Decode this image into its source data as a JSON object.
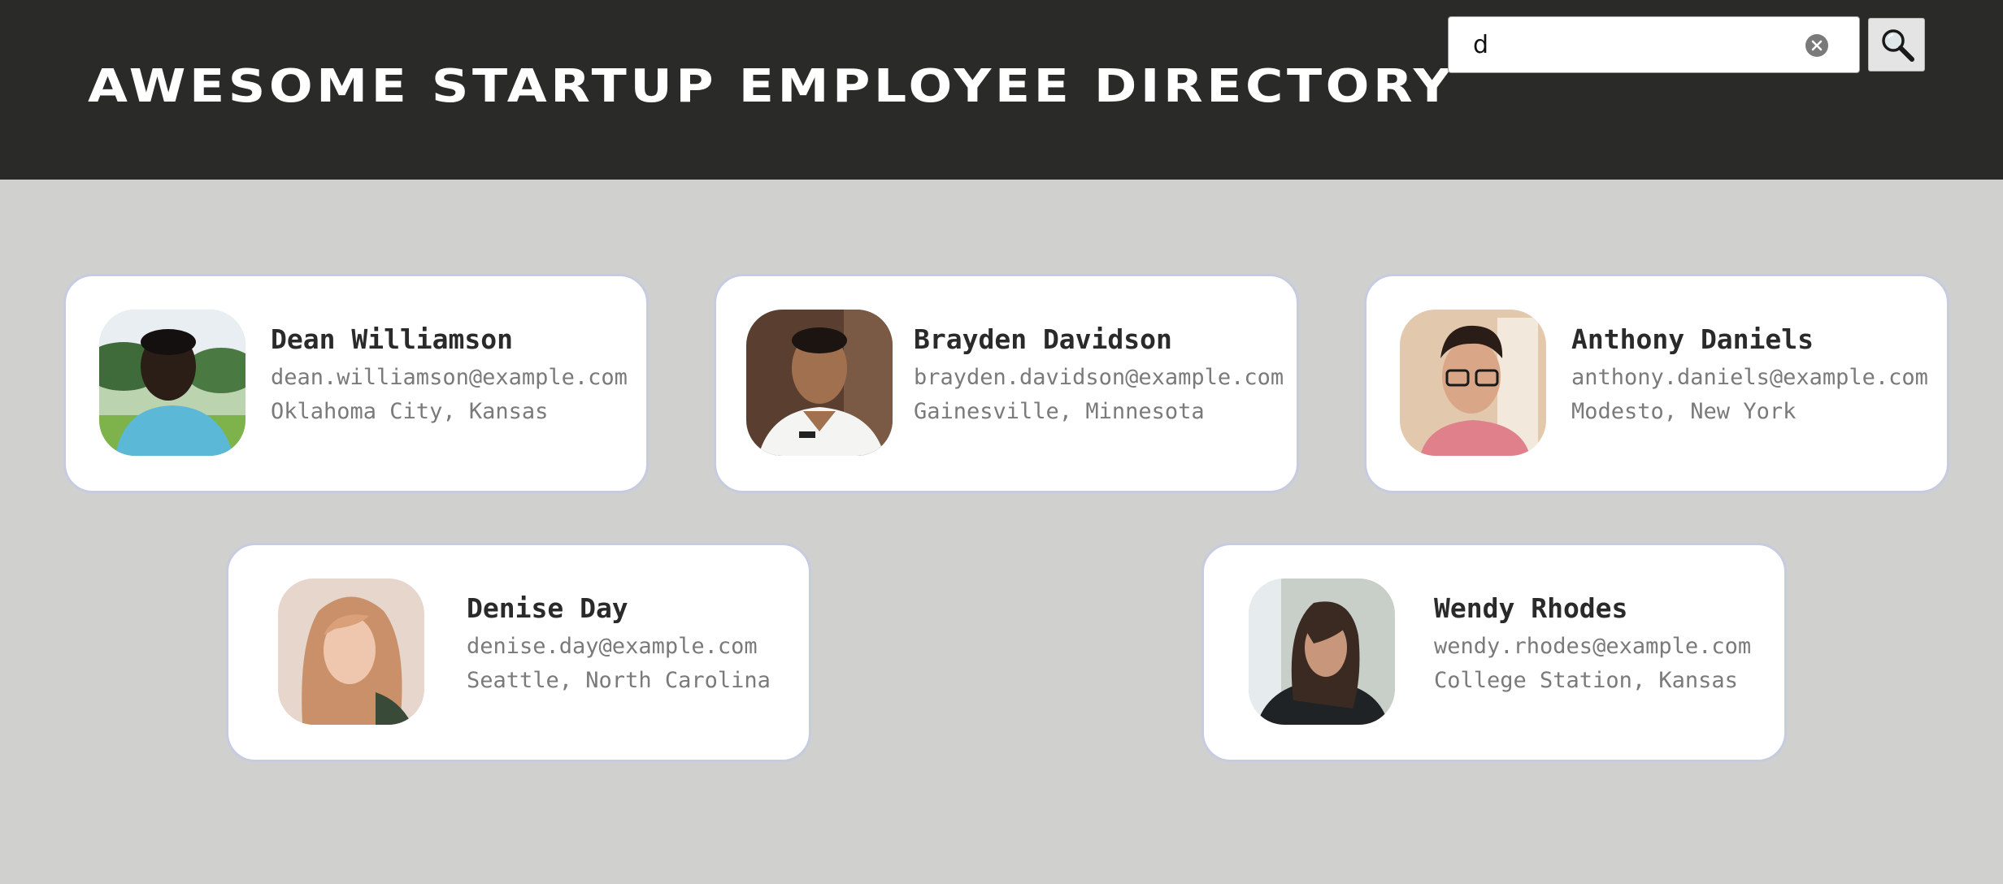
{
  "header": {
    "title": "Awesome Startup Employee Directory",
    "background": "#2a2a29"
  },
  "search": {
    "value": "d",
    "clear_icon": "clear-circle-icon",
    "button_icon": "magnifier-icon"
  },
  "employees": [
    {
      "name": "Dean Williamson",
      "email": "dean.williamson@example.com",
      "location": "Oklahoma City, Kansas"
    },
    {
      "name": "Brayden Davidson",
      "email": "brayden.davidson@example.com",
      "location": "Gainesville, Minnesota"
    },
    {
      "name": "Anthony Daniels",
      "email": "anthony.daniels@example.com",
      "location": "Modesto, New York"
    },
    {
      "name": "Denise Day",
      "email": "denise.day@example.com",
      "location": "Seattle, North Carolina"
    },
    {
      "name": "Wendy Rhodes",
      "email": "wendy.rhodes@example.com",
      "location": "College Station, Kansas"
    }
  ],
  "colors": {
    "page_bg": "#d0d0cf",
    "card_border": "#c6cbe0",
    "name_text": "#2a2a2a",
    "detail_text": "#7a7a7a"
  }
}
